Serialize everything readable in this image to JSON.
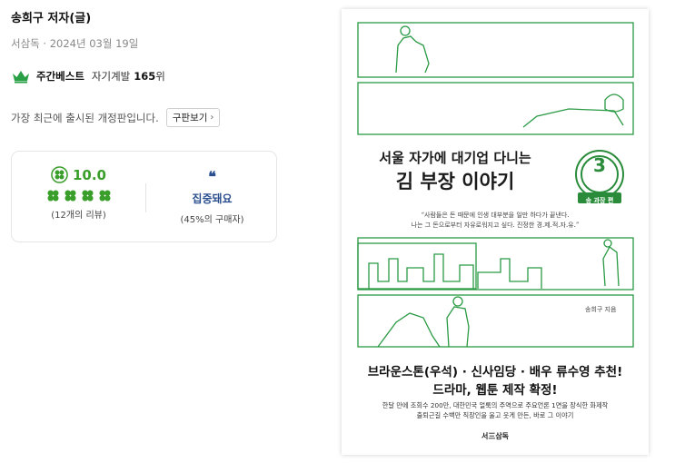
{
  "author": {
    "name": "송희구 저자(글)"
  },
  "publication": {
    "info": "서삼독 · 2024년 03월 19일"
  },
  "bestseller": {
    "label": "주간베스트",
    "category": "자기계발",
    "rank": "165",
    "rank_unit": "위",
    "crown_icon": "crown-icon",
    "crown_color": "#2aa046"
  },
  "revision": {
    "text": "가장 최근에 출시된 개정판입니다.",
    "old_button": "구판보기",
    "chevron_icon": "chevron-right-icon"
  },
  "rating": {
    "score": "10.0",
    "review_count": "(12개의 리뷰)",
    "badge_icon": "clover-badge-icon",
    "clover_icon": "clover-icon",
    "clover_count": 4,
    "color": "#3a9e2b"
  },
  "keyword": {
    "quote_icon": "quote-icon",
    "text": "집중돼요",
    "buyer_ratio": "(45%의 구매자)",
    "color": "#2b4f8f"
  },
  "cover": {
    "title_line1": "서울 자가에 대기업 다니는",
    "title_line2": "김 부장 이야기",
    "volume_number": "3",
    "volume_label": "송 과장 편",
    "blurb_line1": "“사람들은 돈 때문에 인생 대부분을 일만 하다가 끝낸다.",
    "blurb_line2": "나는 그 돈으로부터 자유로워지고 싶다. 진정한 경.제.적.자.유.”",
    "byline": "송희구 지음",
    "headline1": "브라운스톤(우석) · 신사임당 · 배우 류수영 추천!",
    "headline2": "드라마, 웹툰 제작 확정!",
    "description_line1": "한달 만에 조회수 200만, 대한민국 얼룩의 주역으로 주요언론 1면을 장식한 화제작",
    "description_line2": "출퇴근길 수백만 직장인을 울고 웃게 만든, 바로 그 이야기",
    "publisher_mark": "서三삼독",
    "accent_color": "#2a8c3b"
  }
}
